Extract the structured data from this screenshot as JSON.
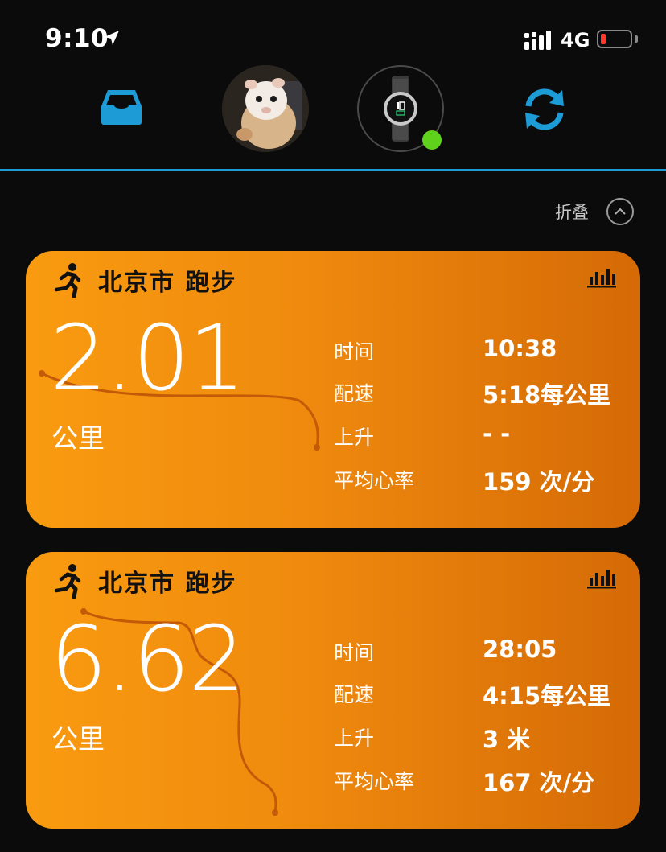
{
  "status_bar": {
    "time": "9:10",
    "network": "4G"
  },
  "nav": {
    "avatar_alt": "profile photo",
    "watch_alt": "watch"
  },
  "collapse": {
    "label": "折叠"
  },
  "activities": [
    {
      "title": "北京市 跑步",
      "distance": "2.01",
      "unit": "公里",
      "metrics": [
        {
          "label": "时间",
          "value": "10:38"
        },
        {
          "label": "配速",
          "value": "5:18每公里"
        },
        {
          "label": "上升",
          "value": "- -"
        },
        {
          "label": "平均心率",
          "value": "159 次/分"
        }
      ]
    },
    {
      "title": "北京市 跑步",
      "distance": "6.62",
      "unit": "公里",
      "metrics": [
        {
          "label": "时间",
          "value": "28:05"
        },
        {
          "label": "配速",
          "value": "4:15每公里"
        },
        {
          "label": "上升",
          "value": "3 米"
        },
        {
          "label": "平均心率",
          "value": "167 次/分"
        }
      ]
    }
  ],
  "colors": {
    "accent": "#1d9bd7",
    "card_start": "#f99b10",
    "card_end": "#d56a06",
    "connected": "#5fd21c",
    "battery_low": "#ff3b30"
  }
}
